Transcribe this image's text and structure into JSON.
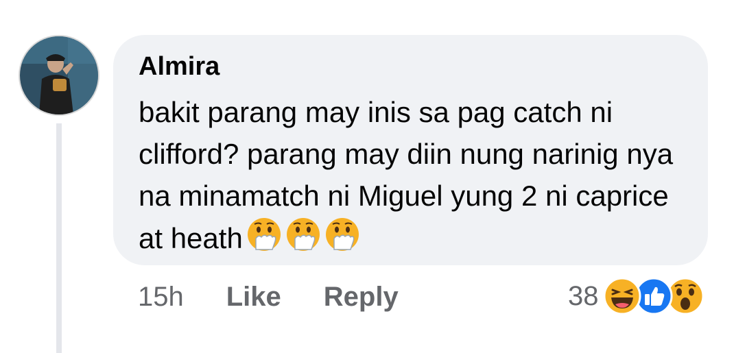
{
  "comment": {
    "author": "Almira",
    "text": "bakit parang may inis sa pag catch ni clifford? parang may diin nung narinig nya na minamatch ni Miguel yung 2 ni caprice at heath",
    "text_emojis": [
      "hand-over-mouth-emoji",
      "hand-over-mouth-emoji",
      "hand-over-mouth-emoji"
    ],
    "time": "15h",
    "like_label": "Like",
    "reply_label": "Reply",
    "reaction_count": "38",
    "reactions": [
      "haha-reaction-icon",
      "like-reaction-icon",
      "wow-reaction-icon"
    ]
  },
  "colors": {
    "bubble_bg": "#f0f2f5",
    "secondary_text": "#65676b",
    "primary_text": "#050505",
    "like_blue": "#1877f2",
    "emoji_yellow": "#f7b125",
    "thread_line": "#e4e6eb"
  }
}
